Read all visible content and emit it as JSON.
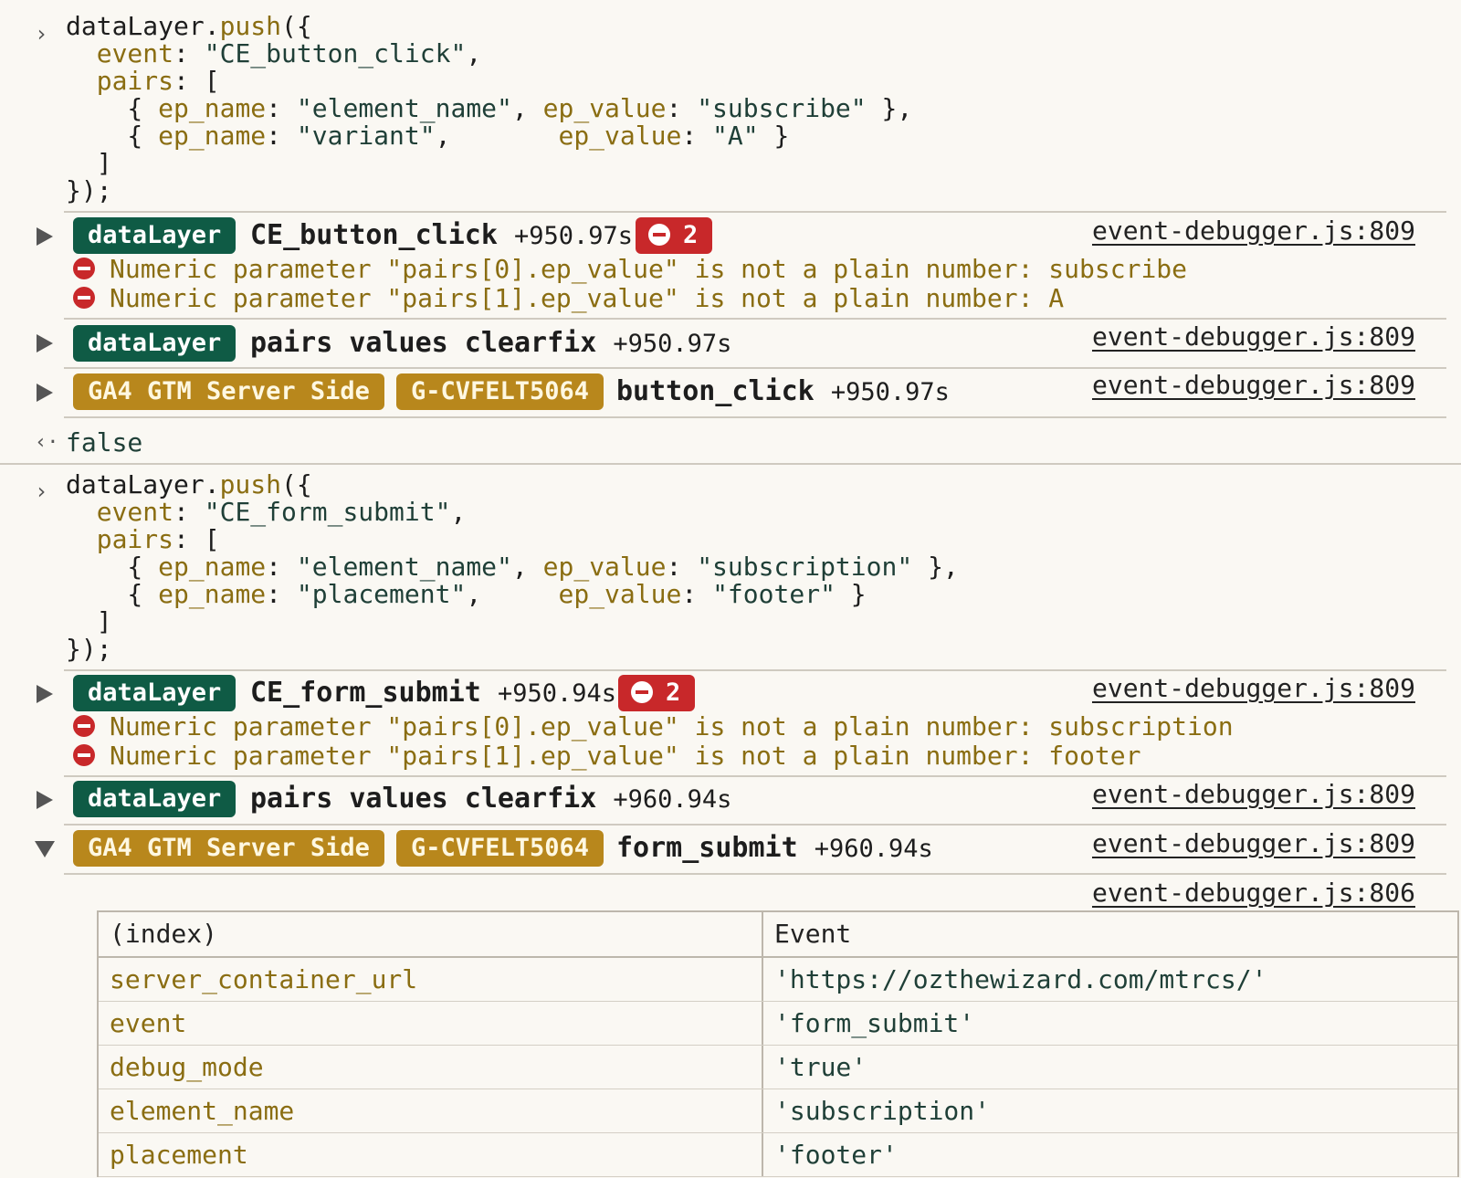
{
  "blocks": [
    {
      "command": {
        "fn_obj": "dataLayer",
        "fn_method": "push",
        "event_key": "event",
        "event_value": "\"CE_button_click\"",
        "pairs_key": "pairs",
        "rows": [
          {
            "name_key": "ep_name",
            "name_val": "\"element_name\"",
            "value_key": "ep_value",
            "value_val": "\"subscribe\""
          },
          {
            "name_key": "ep_name",
            "name_val": "\"variant\"",
            "value_key": "ep_value",
            "value_val": "\"A\""
          }
        ]
      },
      "entries": [
        {
          "badges": [
            "dataLayer"
          ],
          "title": "CE_button_click",
          "time": "+950.97s",
          "error_count": "2",
          "source": "event-debugger.js:809",
          "errors": [
            "Numeric parameter \"pairs[0].ep_value\" is not a plain number: subscribe",
            "Numeric parameter \"pairs[1].ep_value\" is not a plain number: A"
          ]
        },
        {
          "badges": [
            "dataLayer"
          ],
          "title": "pairs values clearfix",
          "time": "+950.97s",
          "source": "event-debugger.js:809"
        },
        {
          "badges": [
            "GA4 GTM Server Side",
            "G-CVFELT5064"
          ],
          "title": "button_click",
          "time": "+950.97s",
          "source": "event-debugger.js:809"
        }
      ],
      "return_value": "false"
    },
    {
      "command": {
        "fn_obj": "dataLayer",
        "fn_method": "push",
        "event_key": "event",
        "event_value": "\"CE_form_submit\"",
        "pairs_key": "pairs",
        "rows": [
          {
            "name_key": "ep_name",
            "name_val": "\"element_name\"",
            "value_key": "ep_value",
            "value_val": "\"subscription\""
          },
          {
            "name_key": "ep_name",
            "name_val": "\"placement\"",
            "value_key": "ep_value",
            "value_val": "\"footer\""
          }
        ]
      },
      "entries": [
        {
          "badges": [
            "dataLayer"
          ],
          "title": "CE_form_submit",
          "time": "+950.94s",
          "error_count": "2",
          "source": "event-debugger.js:809",
          "errors": [
            "Numeric parameter \"pairs[0].ep_value\" is not a plain number: subscription",
            "Numeric parameter \"pairs[1].ep_value\" is not a plain number: footer"
          ]
        },
        {
          "badges": [
            "dataLayer"
          ],
          "title": "pairs values clearfix",
          "time": "+960.94s",
          "source": "event-debugger.js:809"
        },
        {
          "badges": [
            "GA4 GTM Server Side",
            "G-CVFELT5064"
          ],
          "title": "form_submit",
          "time": "+960.94s",
          "source": "event-debugger.js:809"
        }
      ]
    }
  ],
  "table": {
    "source": "event-debugger.js:806",
    "headers": [
      "(index)",
      "Event"
    ],
    "rows": [
      [
        "server_container_url",
        "'https://ozthewizard.com/mtrcs/'"
      ],
      [
        "event",
        "'form_submit'"
      ],
      [
        "debug_mode",
        "'true'"
      ],
      [
        "element_name",
        "'subscription'"
      ],
      [
        "placement",
        "'footer'"
      ]
    ]
  },
  "colors": {
    "background": "#faf8f3",
    "badge_green": "#0f5b45",
    "badge_gold": "#b8871c",
    "error_red": "#c8282a",
    "key_gold": "#8a6d12"
  }
}
